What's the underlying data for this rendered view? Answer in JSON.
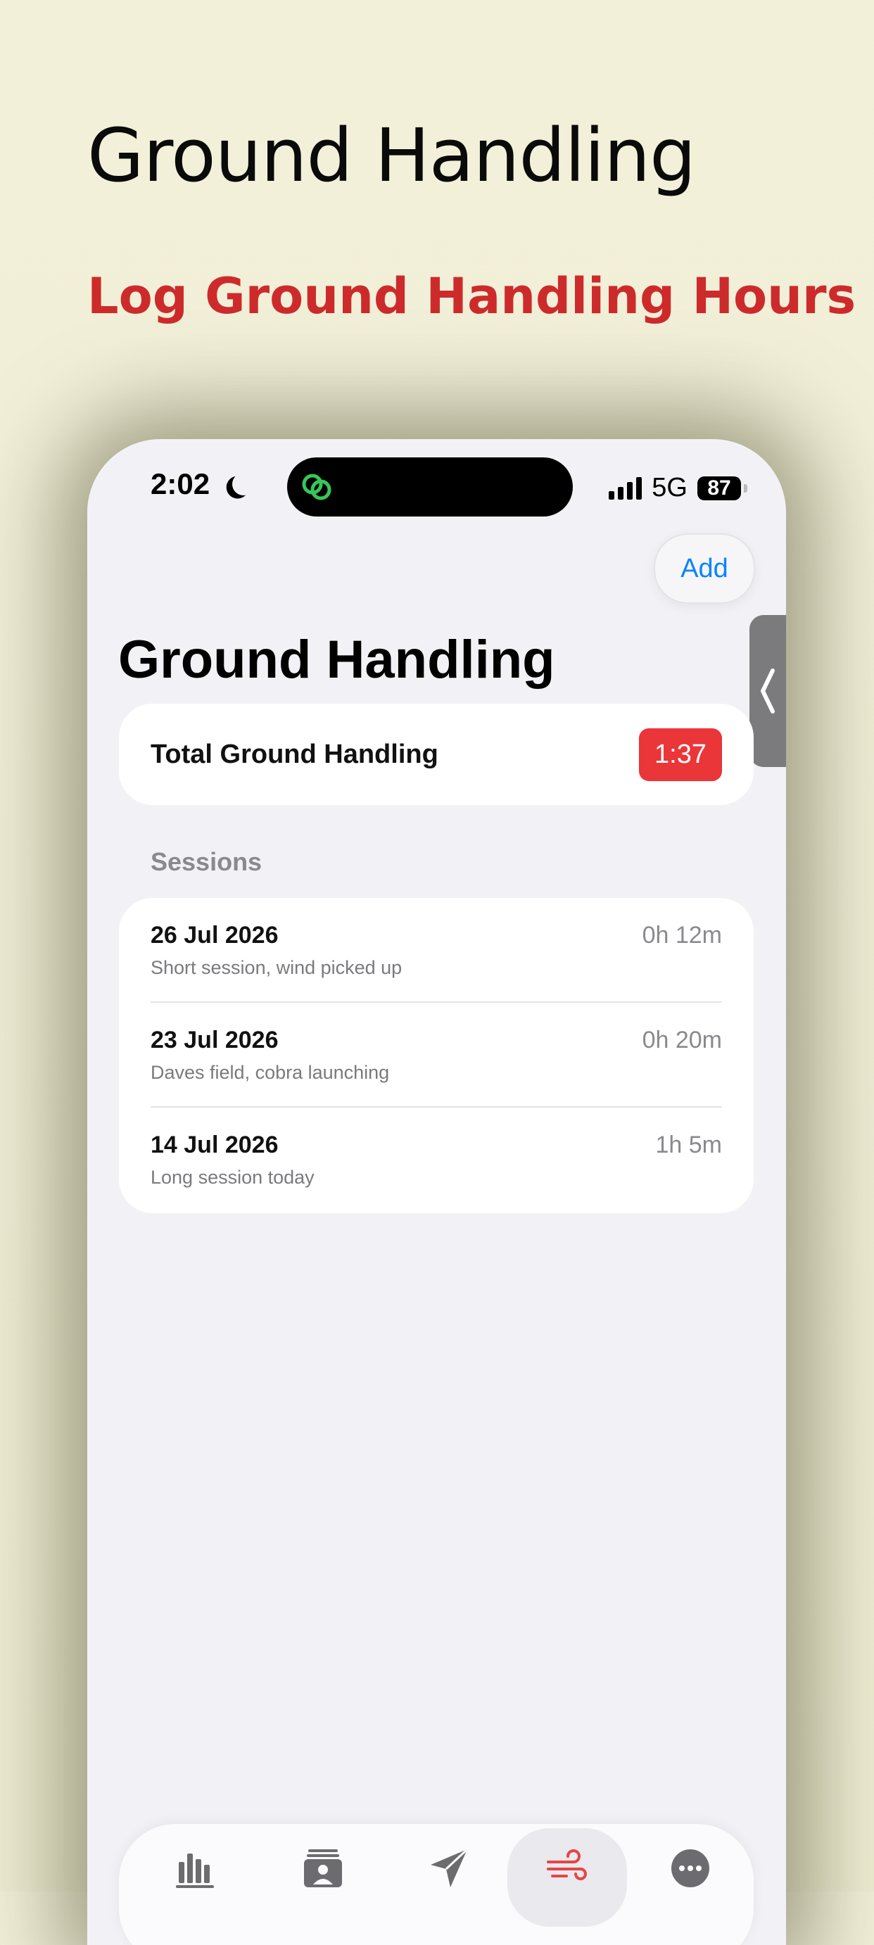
{
  "promo": {
    "title": "Ground Handling",
    "subtitle": "Log Ground Handling Hours"
  },
  "status_bar": {
    "time": "2:02",
    "network": "5G",
    "battery": "87"
  },
  "nav": {
    "add_label": "Add"
  },
  "page": {
    "title": "Ground Handling"
  },
  "summary": {
    "label": "Total Ground Handling",
    "value": "1:37"
  },
  "sessions": {
    "header": "Sessions",
    "items": [
      {
        "date": "26 Jul 2026",
        "note": "Short session, wind picked up",
        "duration": "0h 12m"
      },
      {
        "date": "23 Jul 2026",
        "note": "Daves field, cobra launching",
        "duration": "0h 20m"
      },
      {
        "date": "14 Jul 2026",
        "note": "Long session today",
        "duration": "1h 5m"
      }
    ]
  },
  "tab_bar": {
    "active_color": "#e64545",
    "icons": [
      "bar-chart-icon",
      "pilot-icon",
      "paper-plane-icon",
      "wind-icon",
      "more-icon"
    ]
  }
}
